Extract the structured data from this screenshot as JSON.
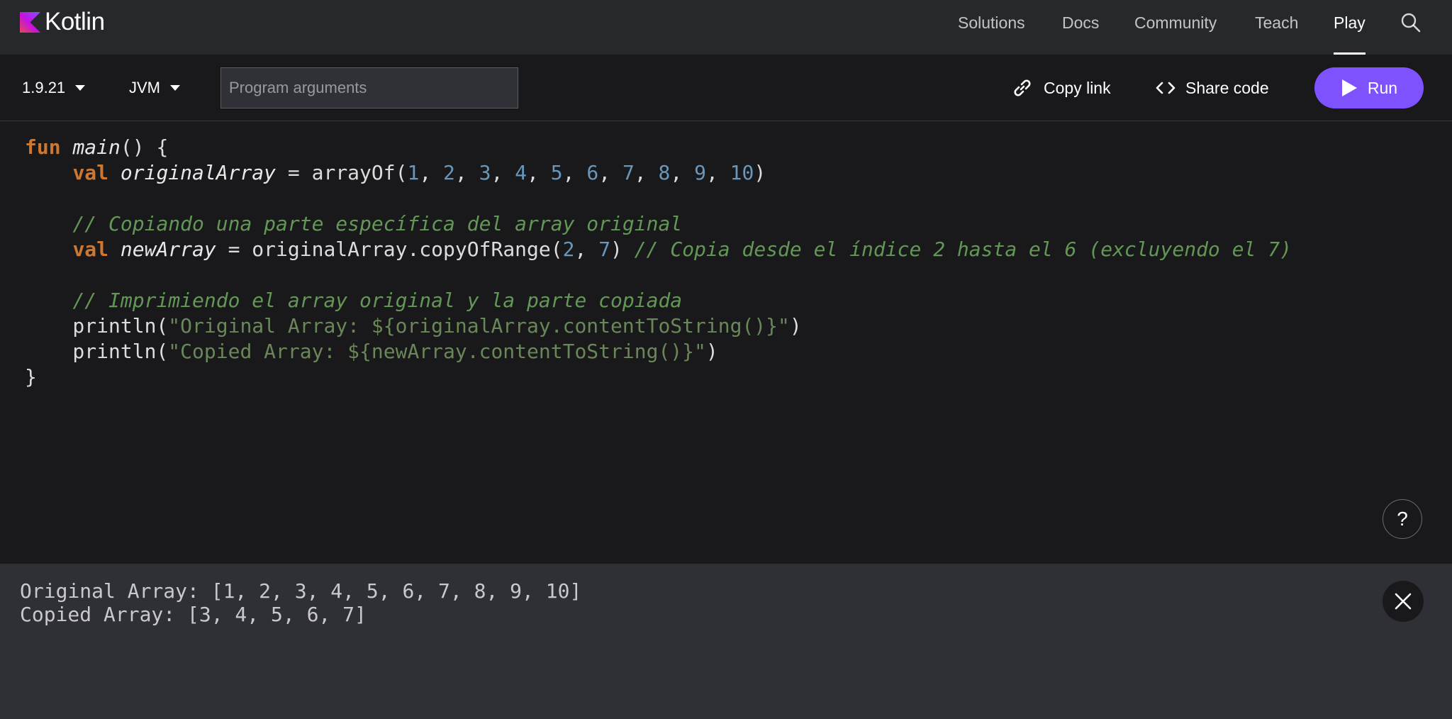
{
  "nav": {
    "logo_text": "Kotlin",
    "items": [
      {
        "label": "Solutions"
      },
      {
        "label": "Docs"
      },
      {
        "label": "Community"
      },
      {
        "label": "Teach"
      },
      {
        "label": "Play"
      }
    ],
    "active": "Play"
  },
  "toolbar": {
    "version": "1.9.21",
    "target": "JVM",
    "args_placeholder": "Program arguments",
    "args_value": "",
    "copy_link_label": "Copy link",
    "share_code_label": "Share code",
    "run_label": "Run"
  },
  "editor": {
    "lines": [
      [
        {
          "t": "fun",
          "c": "kw"
        },
        {
          "t": " "
        },
        {
          "t": "main",
          "c": "fn"
        },
        {
          "t": "() {"
        }
      ],
      [
        {
          "t": "    "
        },
        {
          "t": "val",
          "c": "kw"
        },
        {
          "t": " "
        },
        {
          "t": "originalArray",
          "c": "fn"
        },
        {
          "t": " = arrayOf("
        },
        {
          "t": "1",
          "c": "num"
        },
        {
          "t": ", "
        },
        {
          "t": "2",
          "c": "num"
        },
        {
          "t": ", "
        },
        {
          "t": "3",
          "c": "num"
        },
        {
          "t": ", "
        },
        {
          "t": "4",
          "c": "num"
        },
        {
          "t": ", "
        },
        {
          "t": "5",
          "c": "num"
        },
        {
          "t": ", "
        },
        {
          "t": "6",
          "c": "num"
        },
        {
          "t": ", "
        },
        {
          "t": "7",
          "c": "num"
        },
        {
          "t": ", "
        },
        {
          "t": "8",
          "c": "num"
        },
        {
          "t": ", "
        },
        {
          "t": "9",
          "c": "num"
        },
        {
          "t": ", "
        },
        {
          "t": "10",
          "c": "num"
        },
        {
          "t": ")"
        }
      ],
      [],
      [
        {
          "t": "    "
        },
        {
          "t": "// Copiando una parte específica del array original",
          "c": "cm"
        }
      ],
      [
        {
          "t": "    "
        },
        {
          "t": "val",
          "c": "kw"
        },
        {
          "t": " "
        },
        {
          "t": "newArray",
          "c": "fn"
        },
        {
          "t": " = originalArray.copyOfRange("
        },
        {
          "t": "2",
          "c": "num"
        },
        {
          "t": ", "
        },
        {
          "t": "7",
          "c": "num"
        },
        {
          "t": ") "
        },
        {
          "t": "// Copia desde el índice 2 hasta el 6 (excluyendo el 7)",
          "c": "cm"
        }
      ],
      [],
      [
        {
          "t": "    "
        },
        {
          "t": "// Imprimiendo el array original y la parte copiada",
          "c": "cm"
        }
      ],
      [
        {
          "t": "    println("
        },
        {
          "t": "\"Original Array: ${originalArray.contentToString()}\"",
          "c": "str"
        },
        {
          "t": ")"
        }
      ],
      [
        {
          "t": "    println("
        },
        {
          "t": "\"Copied Array: ${newArray.contentToString()}\"",
          "c": "str"
        },
        {
          "t": ")"
        }
      ],
      [
        {
          "t": "}"
        }
      ]
    ],
    "help_label": "?"
  },
  "output": {
    "lines": [
      "Original Array: [1, 2, 3, 4, 5, 6, 7, 8, 9, 10]",
      "Copied Array: [3, 4, 5, 6, 7]"
    ]
  },
  "colors": {
    "accent": "#7f52ff",
    "keyword": "#cc7832",
    "number": "#6897bb",
    "string": "#6a8759",
    "comment": "#629755"
  }
}
